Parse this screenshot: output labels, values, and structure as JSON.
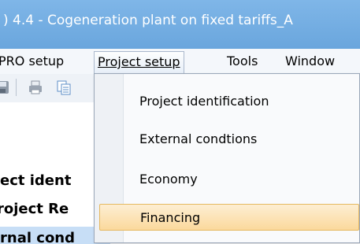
{
  "window": {
    "title": ") 4.4  -  Cogeneration plant on fixed tariffs_A"
  },
  "menubar": {
    "items": [
      {
        "label": "PRO setup"
      },
      {
        "label": "Project setup"
      },
      {
        "label": "Tools"
      },
      {
        "label": "Window"
      }
    ]
  },
  "toolbar": {
    "icons": [
      "save-icon",
      "print-icon",
      "copy-icon"
    ]
  },
  "tree": {
    "items": [
      {
        "label": "ect ident"
      },
      {
        "label": "roject Re"
      },
      {
        "label": "rnal cond"
      }
    ]
  },
  "dropdown": {
    "items": [
      {
        "label": "Project identification"
      },
      {
        "label": "External condtions"
      },
      {
        "label": "Economy"
      },
      {
        "label": "Financing"
      }
    ],
    "highlighted": "Financing"
  },
  "colors": {
    "titlebar": "#6aa6dd",
    "highlight": "#fbd99c",
    "selection": "#c7def6"
  }
}
